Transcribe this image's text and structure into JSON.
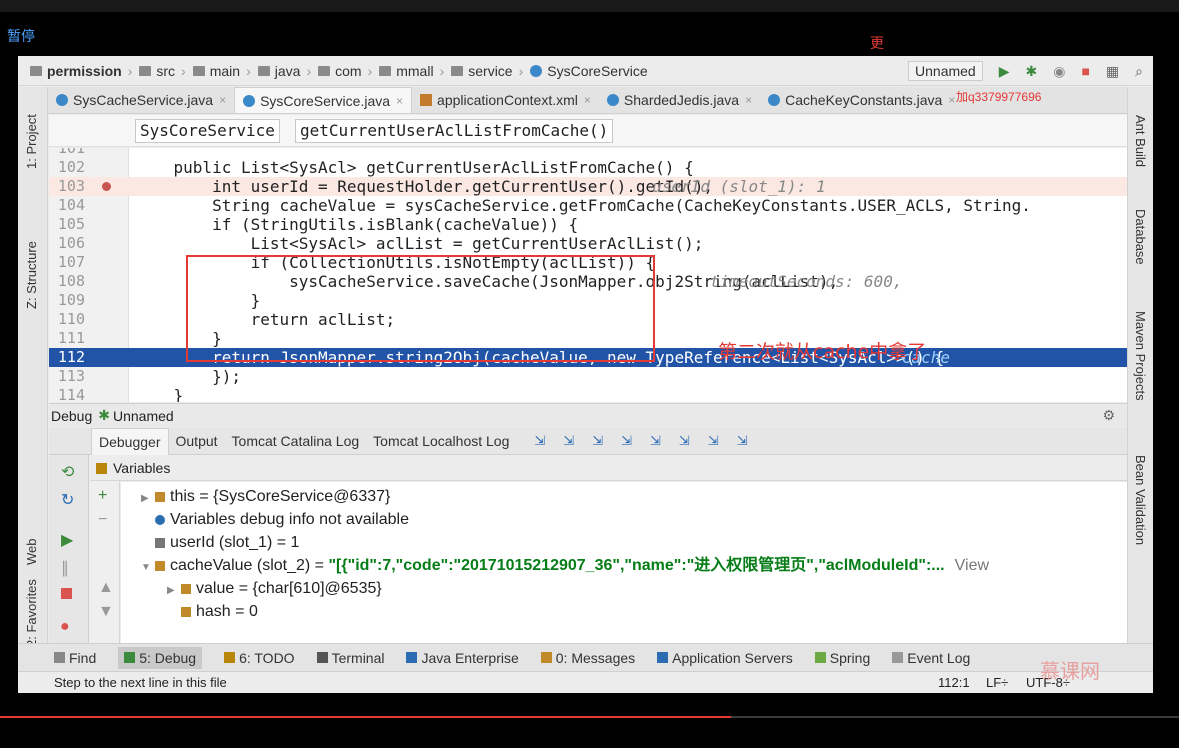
{
  "overlay": {
    "pause_label": "暂停",
    "annotation": "第二次就从cache中拿了",
    "watermark_top": "更",
    "watermark_contact": "加q3379977696",
    "watermark_logo": "慕课网",
    "video_progress": 0.62
  },
  "navbar": {
    "crumbs": [
      {
        "label": "permission",
        "icon": "module-icon"
      },
      {
        "label": "src",
        "icon": "folder-icon"
      },
      {
        "label": "main",
        "icon": "folder-icon"
      },
      {
        "label": "java",
        "icon": "folder-icon"
      },
      {
        "label": "com",
        "icon": "package-icon"
      },
      {
        "label": "mmall",
        "icon": "package-icon"
      },
      {
        "label": "service",
        "icon": "package-icon"
      },
      {
        "label": "SysCoreService",
        "icon": "class-icon"
      }
    ],
    "run_config": "Unnamed"
  },
  "editor_tabs": [
    {
      "label": "SysCacheService.java",
      "icon": "class-icon",
      "active": false
    },
    {
      "label": "SysCoreService.java",
      "icon": "class-icon",
      "active": true
    },
    {
      "label": "applicationContext.xml",
      "icon": "xml-icon",
      "active": false
    },
    {
      "label": "ShardedJedis.java",
      "icon": "class-icon",
      "active": false
    },
    {
      "label": "CacheKeyConstants.java",
      "icon": "class-icon",
      "active": false
    }
  ],
  "left_tools": [
    "1: Project",
    "Z: Structure",
    "Web",
    "2: Favorites"
  ],
  "right_tools": [
    "Ant Build",
    "Database",
    "Maven Projects",
    "Bean Validation"
  ],
  "breadcrumb_boxes": [
    "SysCoreService",
    "getCurrentUserAclListFromCache()"
  ],
  "code_lines": [
    {
      "n": "101",
      "t": ""
    },
    {
      "n": "102",
      "t": "    public List<SysAcl> getCurrentUserAclListFromCache() {"
    },
    {
      "n": "103",
      "t": "        int userId = RequestHolder.getCurrentUser().getId();",
      "hint": "userId (slot_1): 1"
    },
    {
      "n": "104",
      "t": "        String cacheValue = sysCacheService.getFromCache(CacheKeyConstants.USER_ACLS, String."
    },
    {
      "n": "105",
      "t": "        if (StringUtils.isBlank(cacheValue)) {"
    },
    {
      "n": "106",
      "t": "            List<SysAcl> aclList = getCurrentUserAclList();"
    },
    {
      "n": "107",
      "t": "            if (CollectionUtils.isNotEmpty(aclList)) {"
    },
    {
      "n": "108",
      "t": "                sysCacheService.saveCache(JsonMapper.obj2String(aclList), ",
      "hint": "timeoutSeconds: 600,"
    },
    {
      "n": "109",
      "t": "            }"
    },
    {
      "n": "110",
      "t": "            return aclList;"
    },
    {
      "n": "111",
      "t": "        }"
    },
    {
      "n": "112",
      "t": "        return JsonMapper.string2Obj(cacheValue, new TypeReference<List<SysAcl>>() {  ",
      "hint": "cache"
    },
    {
      "n": "113",
      "t": "        });"
    },
    {
      "n": "114",
      "t": "    }"
    }
  ],
  "debug": {
    "title": "Debug",
    "config": "Unnamed",
    "tabs": [
      "Debugger",
      "Output",
      "Tomcat Catalina Log",
      "Tomcat Localhost Log"
    ],
    "variables_label": "Variables",
    "variables": [
      {
        "name": "this",
        "value": " = {SysCoreService@6337}",
        "depth": 0,
        "expand": "▶",
        "icon": "field-icon"
      },
      {
        "name": "Variables debug info not available",
        "value": "",
        "depth": 0,
        "expand": "",
        "icon": "info-icon"
      },
      {
        "name": "userId (slot_1)",
        "value": " = 1",
        "depth": 0,
        "expand": "",
        "icon": "primitive-icon"
      },
      {
        "name": "cacheValue (slot_2)",
        "value": " = ",
        "str": "\"[{\"id\":7,\"code\":\"20171015212907_36\",\"name\":\"进入权限管理页\",\"aclModuleId\":...",
        "view": "View",
        "depth": 0,
        "expand": "▼",
        "icon": "field-icon"
      },
      {
        "name": "value",
        "value": " = {char[610]@6535}",
        "depth": 1,
        "expand": "▶",
        "icon": "field-icon"
      },
      {
        "name": "hash",
        "value": " = 0",
        "depth": 1,
        "expand": "",
        "icon": "field-icon"
      }
    ]
  },
  "bottom_tools": [
    {
      "label": "Find",
      "key": "",
      "active": false
    },
    {
      "label": "5: Debug",
      "key": "",
      "active": true
    },
    {
      "label": "6: TODO",
      "key": "",
      "active": false
    },
    {
      "label": "Terminal",
      "key": "",
      "active": false
    },
    {
      "label": "Java Enterprise",
      "key": "",
      "active": false
    },
    {
      "label": "0: Messages",
      "key": "",
      "active": false
    },
    {
      "label": "Application Servers",
      "key": "",
      "active": false
    },
    {
      "label": "Spring",
      "key": "",
      "active": false
    },
    {
      "label": "Event Log",
      "key": "",
      "active": false
    }
  ],
  "status": {
    "message": "Step to the next line in this file",
    "position": "112:1",
    "line_sep": "LF÷",
    "encoding": "UTF-8÷"
  }
}
